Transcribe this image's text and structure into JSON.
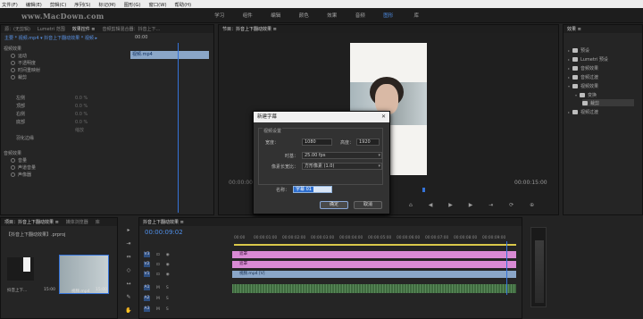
{
  "menubar": [
    "文件(F)",
    "编辑(E)",
    "剪辑(C)",
    "序列(S)",
    "标记(M)",
    "图形(G)",
    "窗口(W)",
    "帮助(H)"
  ],
  "watermark": "www.MacDown.com",
  "workspaces": [
    "学习",
    "组件",
    "编辑",
    "颜色",
    "效果",
    "音频",
    "图形",
    "库"
  ],
  "active_ws": 6,
  "left_panel": {
    "tabs": [
      "源：(无剪辑)",
      "Lumetri 范围",
      "效果控件 ≡",
      "音频剪辑混合器：抖音上下…"
    ],
    "clip": "主要 * 视频.mp4 ▾ 抖音上下翻动效果 * 视频 ▸",
    "video_fx": "视频效果",
    "rows": [
      "运动",
      "不透明度",
      "时间重映射",
      "裁剪",
      "左侧",
      "顶部",
      "右侧",
      "底部",
      "羽化边缘"
    ],
    "values": {
      "left": "0.0 %",
      "top": "0.0 %",
      "right": "0.0 %",
      "bottom": "0.0 %",
      "scale": "缩放"
    },
    "audio_fx": "音频效果",
    "volume": "音量",
    "channel_vol": "声道音量",
    "pan": "声像器",
    "clip_label": "视频.mp4",
    "time_a": "00:00"
  },
  "program": {
    "tab": "节目：抖音上下翻动效果 ≡",
    "timecode": "00:00:00:00",
    "tc_right": "00:00:15:00",
    "fit": "适合"
  },
  "dialog": {
    "title": "新建字幕",
    "section": "视频设置",
    "width_lbl": "宽度：",
    "width": "1080",
    "height_lbl": "高度：",
    "height": "1920",
    "timebase_lbl": "时基：",
    "timebase": "25.00 fps",
    "par_lbl": "像素长宽比：",
    "par": "方形像素 (1.0)",
    "name_lbl": "名称：",
    "name": "字幕 01",
    "ok": "确定",
    "cancel": "取消"
  },
  "project": {
    "tab": "效果 ≡",
    "items": [
      "预设",
      "Lumetri 预设",
      "音频效果",
      "音频过渡",
      "视频效果",
      "视频过渡",
      "变换",
      "裁剪",
      "视频过渡"
    ]
  },
  "bottom_left": {
    "tabs": [
      "项目：抖音上下翻动效果 ≡",
      "媒体浏览器",
      "库"
    ],
    "path": "【抖音上下翻动效果】.prproj",
    "thumb1": "抖音上下...",
    "thumb1_dur": "15:00",
    "thumb2": "视频.mp4",
    "thumb2_dur": "15:00"
  },
  "timeline": {
    "tab": "抖音上下翻动效果 ≡",
    "timecode": "00:00:09:02",
    "ticks": [
      "00:00",
      "00:00:01:00",
      "00:00:02:00",
      "00:00:03:00",
      "00:00:04:00",
      "00:00:05:00",
      "00:00:06:00",
      "00:00:07:00",
      "00:00:08:00",
      "00:00:09:00"
    ],
    "tracks": [
      "V3",
      "V2",
      "V1",
      "A1",
      "A2",
      "A3"
    ],
    "clip_v3": "遮罩",
    "clip_v2": "遮罩",
    "clip_v1": "视频.mp4 [V]"
  },
  "colors": {
    "accent": "#3573d9",
    "pink": "#d98ad4",
    "clip_v1": "#8aa6c8"
  }
}
